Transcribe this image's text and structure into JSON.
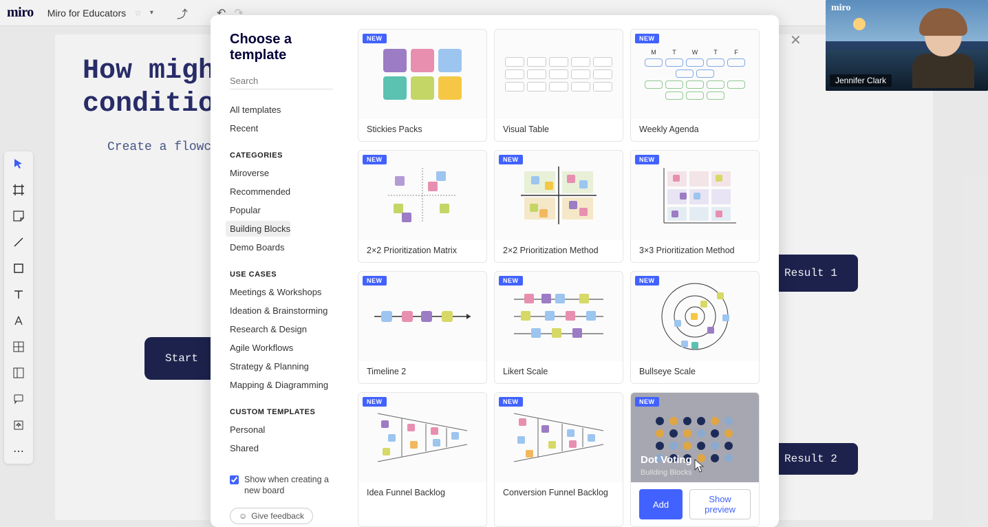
{
  "topbar": {
    "logo": "miro",
    "board_name": "Miro for Educators"
  },
  "canvas": {
    "heading_line1": "How might",
    "heading_line2": "conditiona",
    "subtext": "Create a flowcha",
    "start_label": "Start",
    "result1_label": "Result 1",
    "result2_label": "Result 2"
  },
  "modal": {
    "title": "Choose a template",
    "search_placeholder": "Search",
    "nav": {
      "all": "All templates",
      "recent": "Recent"
    },
    "categories_head": "CATEGORIES",
    "categories": [
      "Miroverse",
      "Recommended",
      "Popular",
      "Building Blocks",
      "Demo Boards"
    ],
    "selected_category_index": 3,
    "usecases_head": "USE CASES",
    "usecases": [
      "Meetings & Workshops",
      "Ideation & Brainstorming",
      "Research & Design",
      "Agile Workflows",
      "Strategy & Planning",
      "Mapping & Diagramming"
    ],
    "custom_head": "CUSTOM TEMPLATES",
    "custom": [
      "Personal",
      "Shared"
    ],
    "show_checkbox_label": "Show when creating a new board",
    "feedback_label": "Give feedback",
    "new_badge": "NEW",
    "templates": [
      {
        "name": "Stickies Packs"
      },
      {
        "name": "Visual Table"
      },
      {
        "name": "Weekly Agenda"
      },
      {
        "name": "2×2 Prioritization Matrix"
      },
      {
        "name": "2×2 Prioritization Method"
      },
      {
        "name": "3×3 Prioritization Method"
      },
      {
        "name": "Timeline 2"
      },
      {
        "name": "Likert Scale"
      },
      {
        "name": "Bullseye Scale"
      },
      {
        "name": "Idea Funnel Backlog"
      },
      {
        "name": "Conversion Funnel Backlog"
      },
      {
        "name": "Dot Voting"
      }
    ],
    "hover_card": {
      "title": "Dot Voting",
      "subtitle": "Building Blocks",
      "add_label": "Add",
      "preview_label": "Show preview"
    },
    "agenda_days": [
      "M",
      "T",
      "W",
      "T",
      "F"
    ]
  },
  "video": {
    "logo": "miro",
    "name": "Jennifer Clark"
  }
}
